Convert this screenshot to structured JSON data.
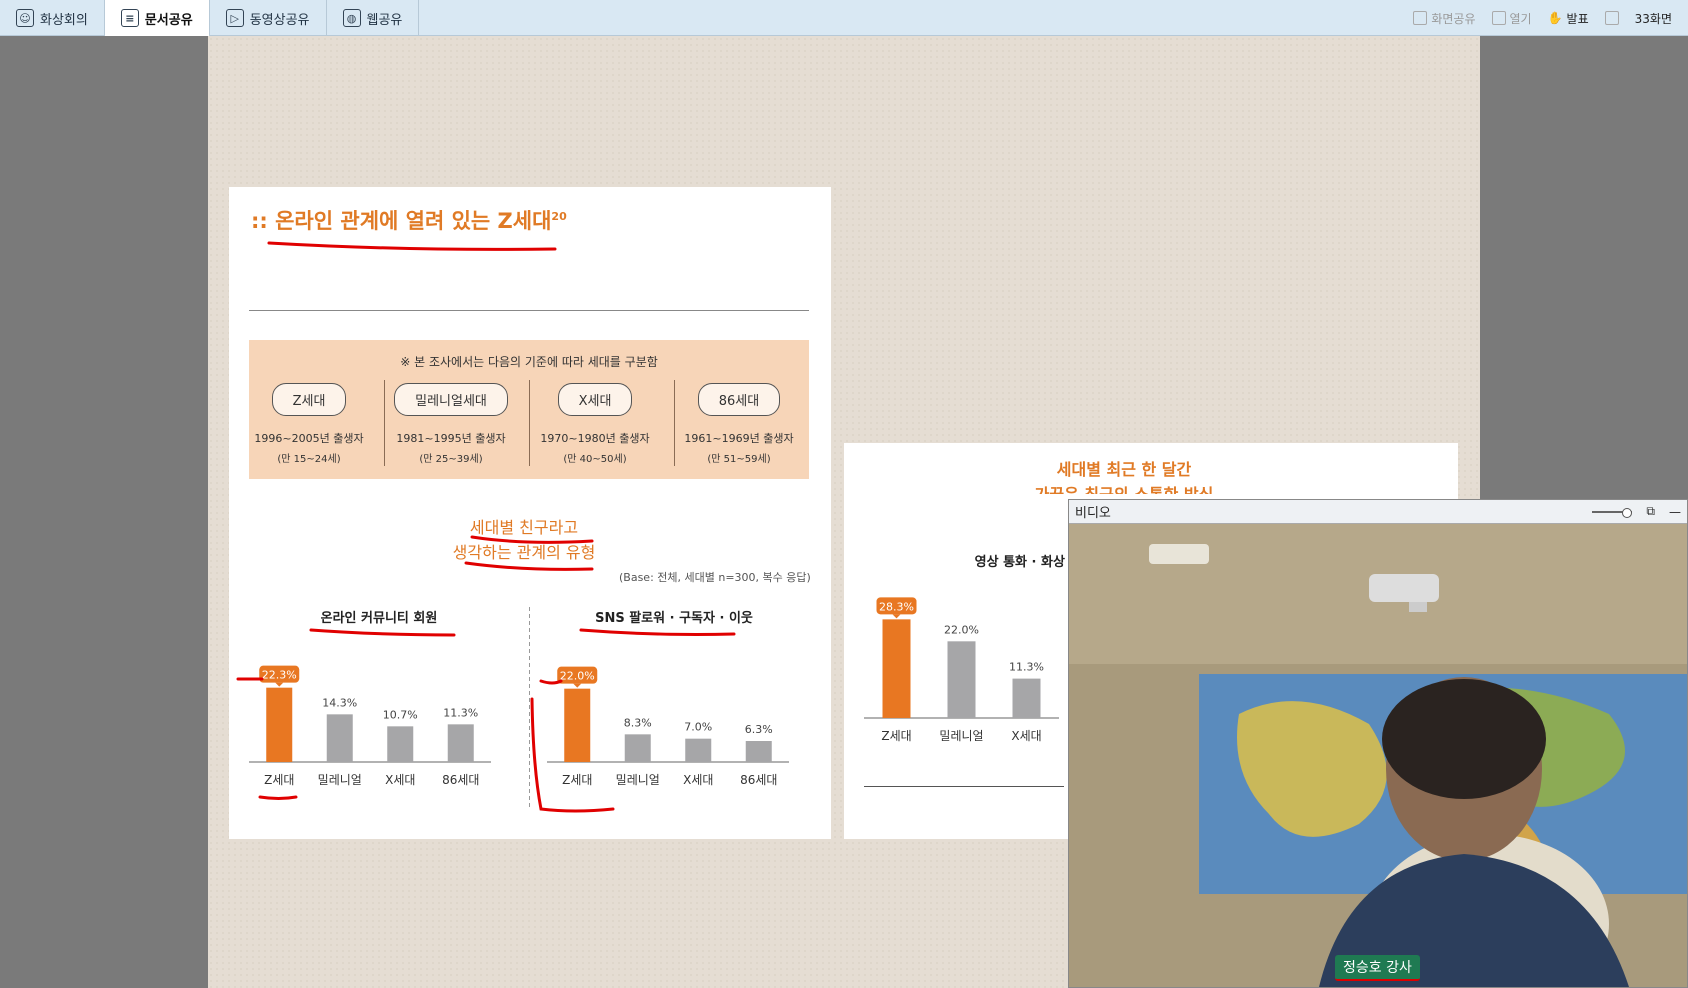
{
  "toolbar": {
    "tabs": [
      {
        "label": "화상회의",
        "active": false
      },
      {
        "label": "문서공유",
        "active": true
      },
      {
        "label": "동영상공유",
        "active": false
      },
      {
        "label": "웹공유",
        "active": false
      }
    ],
    "right": {
      "share_screen": "화면공유",
      "open": "열기",
      "present": "발표",
      "screens": "33화면"
    }
  },
  "slide1": {
    "title": ":: 온라인 관계에 열려 있는 Z세대",
    "title_sup": "20",
    "criteria_note": "※ 본 조사에서는 다음의 기준에 따라 세대를 구분함",
    "generations": [
      {
        "name": "Z세대",
        "born": "1996~2005년 출생자",
        "age": "(만 15~24세)"
      },
      {
        "name": "밀레니얼세대",
        "born": "1981~1995년 출생자",
        "age": "(만 25~39세)"
      },
      {
        "name": "X세대",
        "born": "1970~1980년 출생자",
        "age": "(만 40~50세)"
      },
      {
        "name": "86세대",
        "born": "1961~1969년 출생자",
        "age": "(만 51~59세)"
      }
    ],
    "subtitle_line1": "세대별 친구라고",
    "subtitle_line2": "생각하는 관계의 유형",
    "base_note": "(Base: 전체, 세대별 n=300, 복수 응답)",
    "panel1_title": "온라인 커뮤니티 회원",
    "panel2_title": "SNS 팔로워 · 구독자 · 이웃"
  },
  "slide2": {
    "title_line1": "세대별 최근 한 달간",
    "title_line2": "가끔은 최근의 소통한 방식",
    "panel_title": "영상 통화 · 화상 통화"
  },
  "chart_data": [
    {
      "type": "bar",
      "title": "온라인 커뮤니티 회원",
      "categories": [
        "Z세대",
        "밀레니얼",
        "X세대",
        "86세대"
      ],
      "values": [
        22.3,
        14.3,
        10.7,
        11.3
      ],
      "value_labels": [
        "22.3%",
        "14.3%",
        "10.7%",
        "11.3%"
      ],
      "unit": "%",
      "highlight_index": 0,
      "colors": {
        "highlight": "#e87722",
        "normal": "#a6a6a8"
      },
      "ylim": [
        0,
        30
      ]
    },
    {
      "type": "bar",
      "title": "SNS 팔로워 · 구독자 · 이웃",
      "categories": [
        "Z세대",
        "밀레니얼",
        "X세대",
        "86세대"
      ],
      "values": [
        22.0,
        8.3,
        7.0,
        6.3
      ],
      "value_labels": [
        "22.0%",
        "8.3%",
        "7.0%",
        "6.3%"
      ],
      "unit": "%",
      "highlight_index": 0,
      "colors": {
        "highlight": "#e87722",
        "normal": "#a6a6a8"
      },
      "ylim": [
        0,
        30
      ]
    },
    {
      "type": "bar",
      "title": "영상 통화 · 화상 통화",
      "categories": [
        "Z세대",
        "밀레니얼",
        "X세대"
      ],
      "values": [
        28.3,
        22.0,
        11.3
      ],
      "value_labels": [
        "28.3%",
        "22.0%",
        "11.3%"
      ],
      "unit": "%",
      "highlight_index": 0,
      "colors": {
        "highlight": "#e87722",
        "normal": "#a6a6a8"
      },
      "ylim": [
        0,
        35
      ]
    }
  ],
  "video": {
    "window_title": "비디오",
    "speaker_name": "정승호 강사"
  },
  "colors": {
    "accent": "#e07a25",
    "annotation": "#e00000",
    "toolbar_bg": "#d9e8f3"
  }
}
